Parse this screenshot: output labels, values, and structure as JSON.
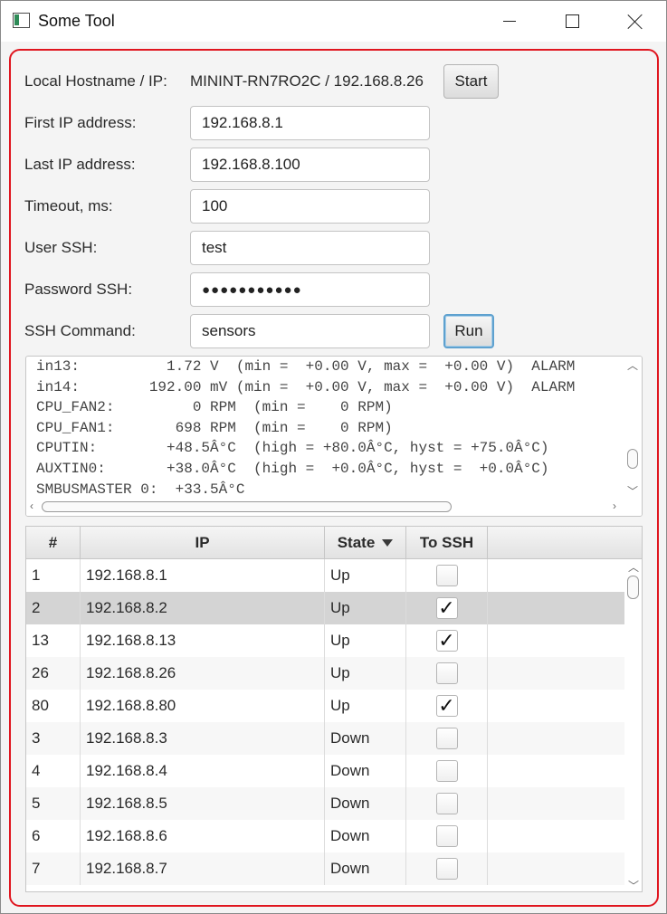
{
  "window": {
    "title": "Some Tool"
  },
  "form": {
    "hostname_label": "Local Hostname / IP:",
    "hostname_value": "MININT-RN7RO2C / 192.168.8.26",
    "start_label": "Start",
    "first_ip_label": "First IP address:",
    "first_ip_value": "192.168.8.1",
    "last_ip_label": "Last IP address:",
    "last_ip_value": "192.168.8.100",
    "timeout_label": "Timeout, ms:",
    "timeout_value": "100",
    "user_label": "User SSH:",
    "user_value": "test",
    "password_label": "Password SSH:",
    "password_value": "●●●●●●●●●●●",
    "command_label": "SSH Command:",
    "command_value": "sensors",
    "run_label": "Run"
  },
  "console": {
    "lines": [
      "in13:          1.72 V  (min =  +0.00 V, max =  +0.00 V)  ALARM",
      "in14:        192.00 mV (min =  +0.00 V, max =  +0.00 V)  ALARM",
      "CPU_FAN2:         0 RPM  (min =    0 RPM)",
      "CPU_FAN1:       698 RPM  (min =    0 RPM)",
      "CPUTIN:        +48.5Â°C  (high = +80.0Â°C, hyst = +75.0Â°C)",
      "AUXTIN0:       +38.0Â°C  (high =  +0.0Â°C, hyst =  +0.0Â°C)",
      "SMBUSMASTER 0:  +33.5Â°C"
    ]
  },
  "table": {
    "columns": [
      "#",
      "IP",
      "State",
      "To SSH"
    ],
    "rows": [
      {
        "num": "1",
        "ip": "192.168.8.1",
        "state": "Up",
        "ssh": false
      },
      {
        "num": "2",
        "ip": "192.168.8.2",
        "state": "Up",
        "ssh": true
      },
      {
        "num": "13",
        "ip": "192.168.8.13",
        "state": "Up",
        "ssh": true
      },
      {
        "num": "26",
        "ip": "192.168.8.26",
        "state": "Up",
        "ssh": false
      },
      {
        "num": "80",
        "ip": "192.168.8.80",
        "state": "Up",
        "ssh": true
      },
      {
        "num": "3",
        "ip": "192.168.8.3",
        "state": "Down",
        "ssh": false
      },
      {
        "num": "4",
        "ip": "192.168.8.4",
        "state": "Down",
        "ssh": false
      },
      {
        "num": "5",
        "ip": "192.168.8.5",
        "state": "Down",
        "ssh": false
      },
      {
        "num": "6",
        "ip": "192.168.8.6",
        "state": "Down",
        "ssh": false
      },
      {
        "num": "7",
        "ip": "192.168.8.7",
        "state": "Down",
        "ssh": false
      }
    ],
    "selected_row": 1
  },
  "colors": {
    "panel_border": "#e0161f",
    "focus_ring": "#5ea1cf",
    "selected_row": "#d4d4d4"
  }
}
